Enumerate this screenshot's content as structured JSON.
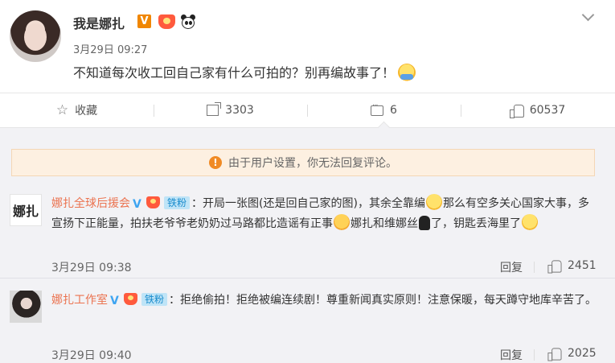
{
  "post": {
    "author": "我是娜扎",
    "verified_badge": "V",
    "timestamp": "3月29日 09:27",
    "text": "不知道每次收工回自己家有什么可拍的？别再编故事了！",
    "emoji": "hug-emoji"
  },
  "actions": {
    "favorite_label": "收藏",
    "share_count": "3303",
    "comment_count": "6",
    "like_count": "60537"
  },
  "notice": {
    "icon": "!",
    "text": "由于用户设置，你无法回复评论。"
  },
  "comments": [
    {
      "avatar_text": "娜扎",
      "user": "娜扎全球后援会",
      "fan_badge": "铁粉",
      "text_part1": "：开局一张图(还是回自己家的图)，其余全靠编",
      "text_part2": "那么有空多关心国家大事，多宣扬下正能量，拍扶老爷爷老奶奶过马路都比造谣有正事",
      "text_part3": "娜扎和维娜丝",
      "text_part4": "了，钥匙丢海里了",
      "time": "3月29日 09:38",
      "reply_label": "回复",
      "likes": "2451"
    },
    {
      "user": "娜扎工作室",
      "fan_badge": "铁粉",
      "text": "：拒绝偷拍！拒绝被编连续剧！尊重新闻真实原则！注意保暖，每天蹲守地库辛苦了。",
      "time": "3月29日 09:40",
      "reply_label": "回复",
      "likes": "2025"
    }
  ]
}
